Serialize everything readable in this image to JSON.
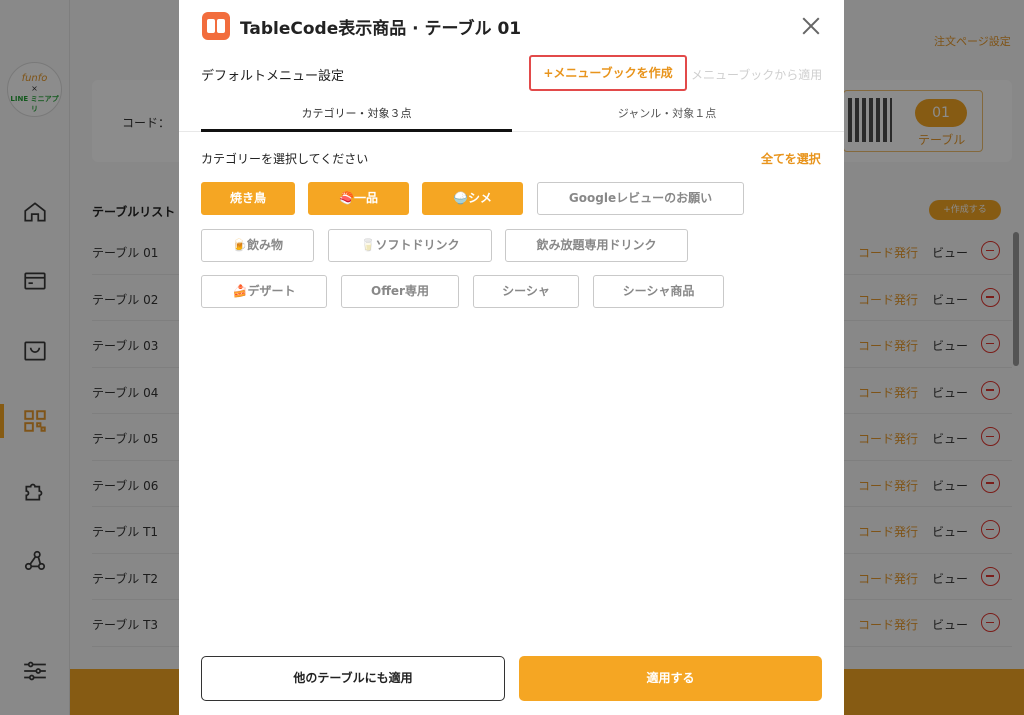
{
  "background": {
    "logo": {
      "line1": "funfo",
      "line2": "×",
      "line3": "LINE ミニアプリ"
    },
    "topbar_link": "注文ページ設定",
    "code_label": "コード：",
    "qr": {
      "number": "01",
      "label": "テーブル"
    },
    "list_title": "テーブルリスト",
    "add_label": "+作成する",
    "row_actions": {
      "issue": "コード発行",
      "view": "ビュー"
    },
    "rows": [
      "テーブル 01",
      "テーブル 02",
      "テーブル 03",
      "テーブル 04",
      "テーブル 05",
      "テーブル 06",
      "テーブル T1",
      "テーブル T2",
      "テーブル T3"
    ]
  },
  "modal": {
    "title": "TableCode表示商品 · テーブル 01",
    "default_menu_label": "デフォルトメニュー設定",
    "create_menubook": "+メニューブックを作成",
    "apply_from_menubook": "メニューブックから適用",
    "tabs": [
      {
        "label": "カテゴリー・対象３点",
        "active": true
      },
      {
        "label": "ジャンル・対象１点",
        "active": false
      }
    ],
    "select_prompt": "カテゴリーを選択してください",
    "select_all": "全てを選択",
    "chips": [
      {
        "label": "焼き鳥",
        "selected": true
      },
      {
        "label": "🍣一品",
        "selected": true
      },
      {
        "label": "🍚シメ",
        "selected": true
      },
      {
        "label": "Googleレビューのお願い",
        "selected": false
      },
      {
        "label": "🍺飲み物",
        "selected": false
      },
      {
        "label": "🥛ソフトドリンク",
        "selected": false
      },
      {
        "label": "飲み放題専用ドリンク",
        "selected": false
      },
      {
        "label": "🍰デザート",
        "selected": false
      },
      {
        "label": "Offer専用",
        "selected": false
      },
      {
        "label": "シーシャ",
        "selected": false
      },
      {
        "label": "シーシャ商品",
        "selected": false
      }
    ],
    "footer": {
      "other_tables": "他のテーブルにも適用",
      "apply": "適用する"
    }
  },
  "colors": {
    "accent": "#f5a623",
    "accent_text": "#e8941c",
    "danger": "#e0352f",
    "highlight_border": "#e24a4a"
  }
}
